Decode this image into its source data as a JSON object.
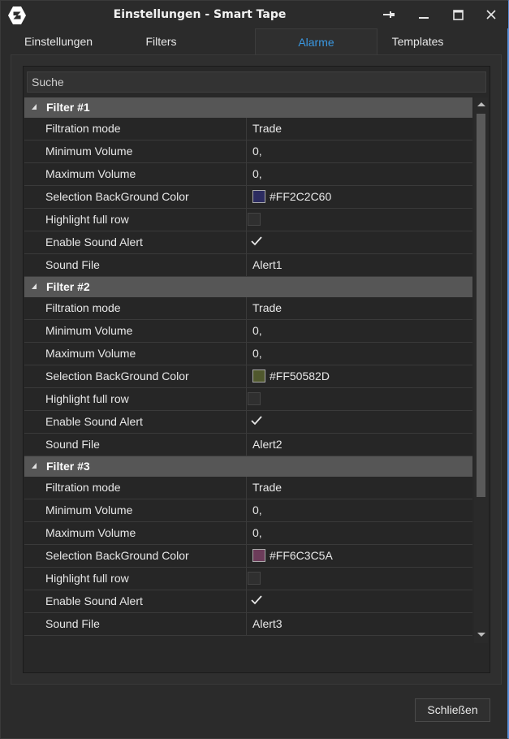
{
  "window": {
    "title": "Einstellungen - Smart Tape"
  },
  "tabs": [
    {
      "label": "Einstellungen",
      "active": false
    },
    {
      "label": "Filters",
      "active": false
    },
    {
      "label": "Alarme",
      "active": true
    },
    {
      "label": "Templates",
      "active": false
    }
  ],
  "search": {
    "placeholder": "Suche"
  },
  "groups": [
    {
      "title": "Filter #1",
      "rows": [
        {
          "name": "Filtration mode",
          "type": "text",
          "value": "Trade"
        },
        {
          "name": "Minimum Volume",
          "type": "text",
          "value": "0,"
        },
        {
          "name": "Maximum Volume",
          "type": "text",
          "value": "0,"
        },
        {
          "name": "Selection BackGround Color",
          "type": "color",
          "value": "#FF2C2C60",
          "swatch": "#2C2C60"
        },
        {
          "name": "Highlight full row",
          "type": "checkbox",
          "checked": false
        },
        {
          "name": "Enable Sound Alert",
          "type": "checkbox",
          "checked": true
        },
        {
          "name": "Sound File",
          "type": "text",
          "value": "Alert1"
        }
      ]
    },
    {
      "title": "Filter #2",
      "rows": [
        {
          "name": "Filtration mode",
          "type": "text",
          "value": "Trade"
        },
        {
          "name": "Minimum Volume",
          "type": "text",
          "value": "0,"
        },
        {
          "name": "Maximum Volume",
          "type": "text",
          "value": "0,"
        },
        {
          "name": "Selection BackGround Color",
          "type": "color",
          "value": "#FF50582D",
          "swatch": "#50582D"
        },
        {
          "name": "Highlight full row",
          "type": "checkbox",
          "checked": false
        },
        {
          "name": "Enable Sound Alert",
          "type": "checkbox",
          "checked": true
        },
        {
          "name": "Sound File",
          "type": "text",
          "value": "Alert2"
        }
      ]
    },
    {
      "title": "Filter #3",
      "rows": [
        {
          "name": "Filtration mode",
          "type": "text",
          "value": "Trade"
        },
        {
          "name": "Minimum Volume",
          "type": "text",
          "value": "0,"
        },
        {
          "name": "Maximum Volume",
          "type": "text",
          "value": "0,"
        },
        {
          "name": "Selection BackGround Color",
          "type": "color",
          "value": "#FF6C3C5A",
          "swatch": "#6C3C5A"
        },
        {
          "name": "Highlight full row",
          "type": "checkbox",
          "checked": false
        },
        {
          "name": "Enable Sound Alert",
          "type": "checkbox",
          "checked": true
        },
        {
          "name": "Sound File",
          "type": "text",
          "value": "Alert3"
        }
      ]
    }
  ],
  "footer": {
    "close_label": "Schließen"
  },
  "colors": {
    "accent": "#3A97E0",
    "group_header": "#565656"
  }
}
